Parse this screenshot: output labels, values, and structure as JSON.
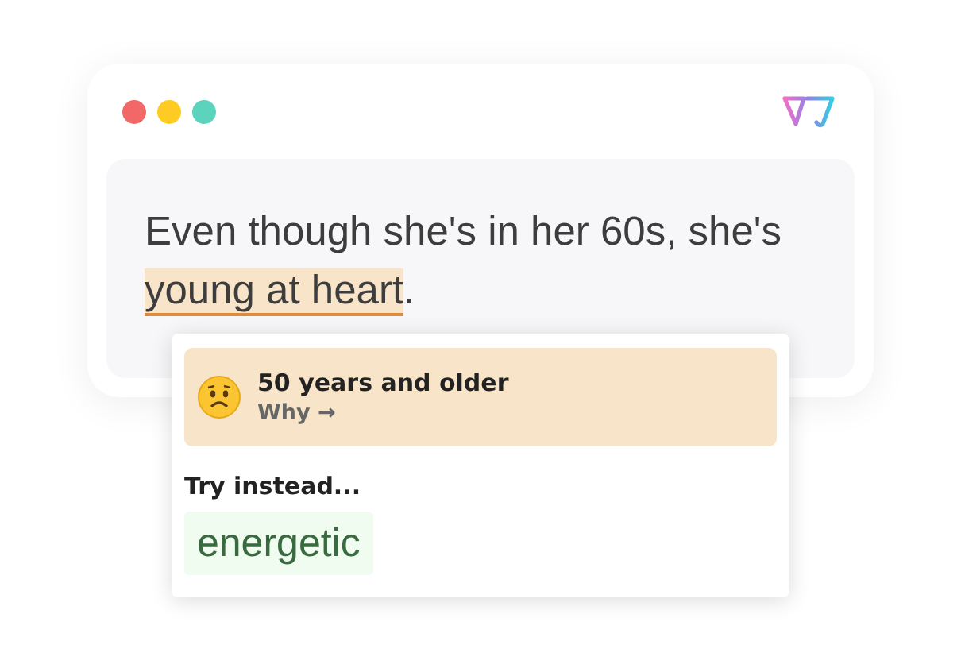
{
  "window": {
    "dots": [
      {
        "color": "#f26868"
      },
      {
        "color": "#fdcb21"
      },
      {
        "color": "#5bd3bd"
      }
    ]
  },
  "editor": {
    "text_before": "Even though she's in her 60s, she's",
    "flagged": "young at heart",
    "text_after": "."
  },
  "suggestion": {
    "category": "50 years and older",
    "why": "Why →",
    "try_label": "Try instead...",
    "alternatives": [
      "energetic"
    ]
  }
}
